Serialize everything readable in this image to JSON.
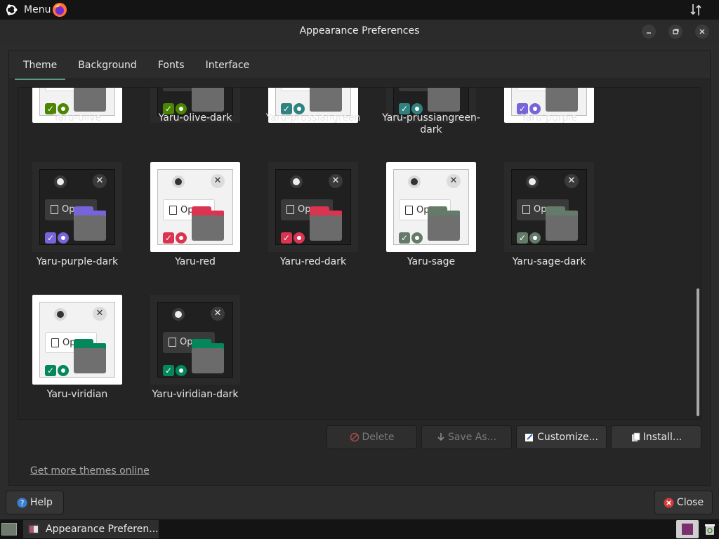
{
  "top_panel": {
    "menu_label": "Menu"
  },
  "window": {
    "title": "Appearance Preferences"
  },
  "tabs": [
    {
      "label": "Theme",
      "active": true
    },
    {
      "label": "Background"
    },
    {
      "label": "Fonts"
    },
    {
      "label": "Interface"
    }
  ],
  "themes": [
    {
      "name": "Yaru-olive",
      "style": "light",
      "accent": "#4b8501"
    },
    {
      "name": "Yaru-olive-dark",
      "style": "dark",
      "accent": "#4b8501"
    },
    {
      "name": "Yaru-prussiangreen",
      "style": "light",
      "accent": "#308280"
    },
    {
      "name": "Yaru-prussiangreen-dark",
      "style": "dark",
      "accent": "#308280"
    },
    {
      "name": "Yaru-purple",
      "style": "light",
      "accent": "#7764d8"
    },
    {
      "name": "Yaru-purple-dark",
      "style": "dark",
      "accent": "#7764d8"
    },
    {
      "name": "Yaru-red",
      "style": "light",
      "accent": "#da3450"
    },
    {
      "name": "Yaru-red-dark",
      "style": "dark",
      "accent": "#da3450"
    },
    {
      "name": "Yaru-sage",
      "style": "light",
      "accent": "#657b69"
    },
    {
      "name": "Yaru-sage-dark",
      "style": "dark",
      "accent": "#657b69"
    },
    {
      "name": "Yaru-viridian",
      "style": "light",
      "accent": "#03875b"
    },
    {
      "name": "Yaru-viridian-dark",
      "style": "dark",
      "accent": "#03875b"
    }
  ],
  "preview_field_text": "Op",
  "actions": {
    "delete": "Delete",
    "save_as": "Save As...",
    "customize": "Customize...",
    "install": "Install..."
  },
  "get_more_link": "Get more themes online",
  "footer": {
    "help": "Help",
    "close": "Close"
  },
  "taskbar": {
    "item_label": "Appearance Preferen..."
  }
}
